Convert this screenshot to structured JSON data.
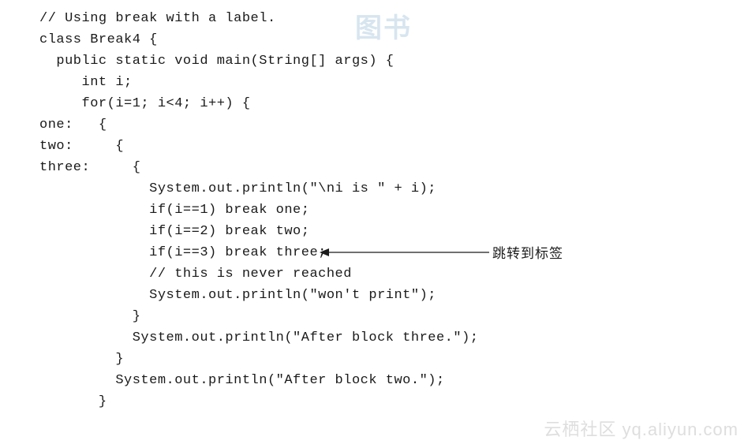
{
  "code": {
    "l1": "// Using break with a label.",
    "l2": "class Break4 {",
    "l3": "  public static void main(String[] args) {",
    "l4": "     int i;",
    "l5": "",
    "l6": "     for(i=1; i<4; i++) {",
    "l7": "one:   {",
    "l8": "two:     {",
    "l9": "three:     {",
    "l10": "             System.out.println(\"\\ni is \" + i);",
    "l11": "             if(i==1) break one;",
    "l12": "             if(i==2) break two;",
    "l13": "             if(i==3) break three;",
    "l14": "",
    "l15": "             // this is never reached",
    "l16": "             System.out.println(\"won't print\");",
    "l17": "           }",
    "l18": "           System.out.println(\"After block three.\");",
    "l19": "         }",
    "l20": "         System.out.println(\"After block two.\");",
    "l21": "       }"
  },
  "annotation": {
    "label": "跳转到标签"
  },
  "watermarks": {
    "top": "图书",
    "bottom": "云栖社区 yq.aliyun.com"
  }
}
